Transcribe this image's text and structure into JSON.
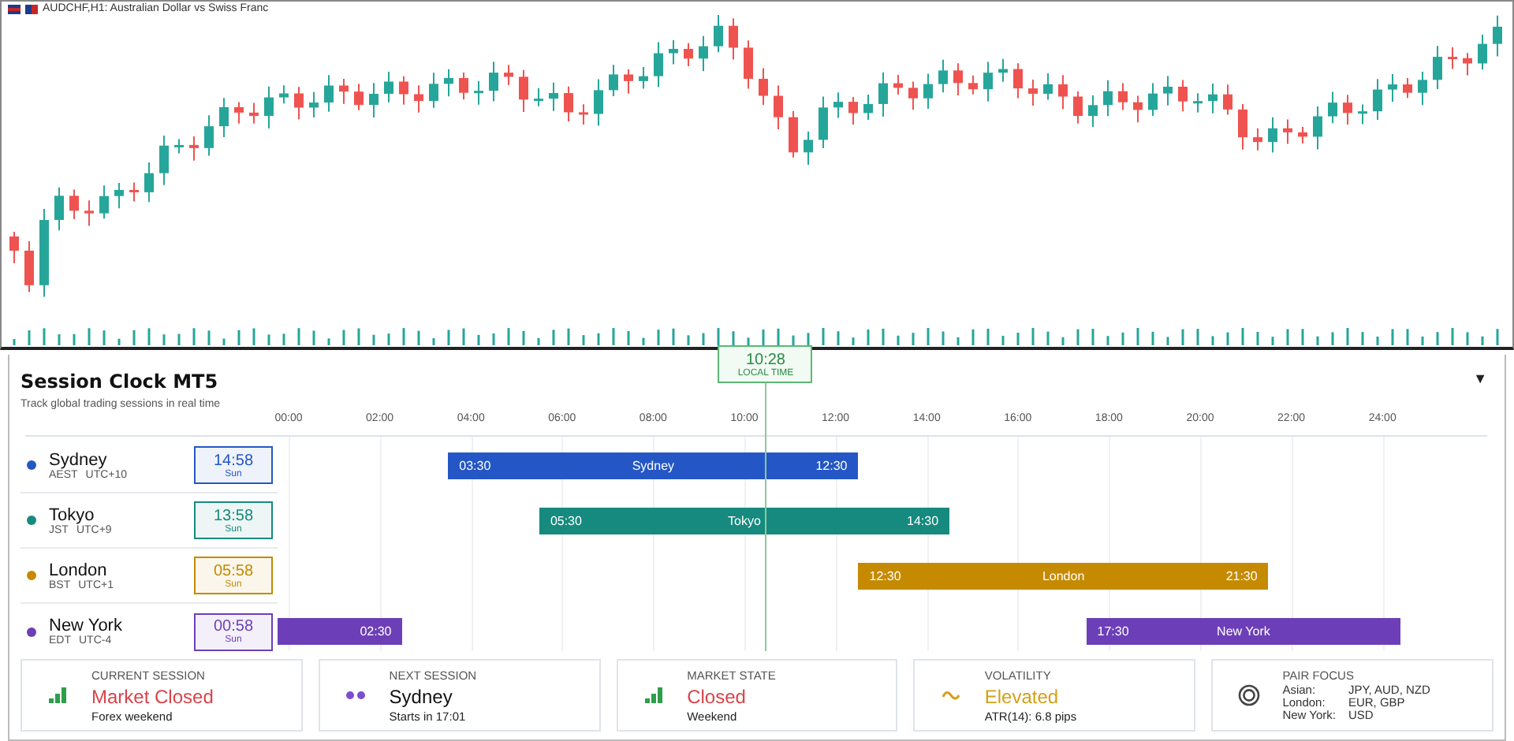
{
  "chart_window": {
    "title": "AUDCHF,H1: Australian Dollar vs Swiss Franc"
  },
  "session_clock": {
    "title": "Session Clock MT5",
    "subtitle": "Track global trading sessions in real time",
    "menu": "▼",
    "local_time": {
      "time": "10:28",
      "label": "LOCAL TIME"
    },
    "axis_labels": [
      "00:00",
      "02:00",
      "04:00",
      "06:00",
      "08:00",
      "10:00",
      "12:00",
      "14:00",
      "16:00",
      "18:00",
      "20:00",
      "22:00",
      "24:00"
    ],
    "sessions": [
      {
        "name": "Sydney",
        "zone": "AEST",
        "offset": "UTC+10",
        "time": "14:58",
        "day": "Sun",
        "color": "#2457c5",
        "open": "03:30",
        "close": "12:30",
        "bar_label": "Sydney"
      },
      {
        "name": "Tokyo",
        "zone": "JST",
        "offset": "UTC+9",
        "time": "13:58",
        "day": "Sun",
        "color": "#168a7e",
        "open": "05:30",
        "close": "14:30",
        "bar_label": "Tokyo"
      },
      {
        "name": "London",
        "zone": "BST",
        "offset": "UTC+1",
        "time": "05:58",
        "day": "Sun",
        "color": "#c58a00",
        "open": "12:30",
        "close": "21:30",
        "bar_label": "London"
      },
      {
        "name": "New York",
        "zone": "EDT",
        "offset": "UTC-4",
        "time": "00:58",
        "day": "Sun",
        "color": "#6c3fb8",
        "open": "17:30",
        "close": "02:30",
        "bar_label": "New York"
      }
    ]
  },
  "cards": [
    {
      "kind": "signal",
      "label": "CURRENT SESSION",
      "value": "Market Closed",
      "color": "#d9434a",
      "detail": "Forex weekend"
    },
    {
      "kind": "dots",
      "label": "NEXT SESSION",
      "value": "Sydney",
      "color": "#111111",
      "detail": "Starts in 17:01"
    },
    {
      "kind": "signal",
      "label": "MARKET STATE",
      "value": "Closed",
      "color": "#d9434a",
      "detail": "Weekend"
    },
    {
      "kind": "wave",
      "label": "VOLATILITY",
      "value": "Elevated",
      "color": "#d4a017",
      "detail": "ATR(14): 6.8 pips"
    },
    {
      "kind": "target",
      "label": "PAIR FOCUS",
      "pairs": [
        {
          "region": "Asian:",
          "list": "JPY, AUD, NZD"
        },
        {
          "region": "London:",
          "list": "EUR, GBP"
        },
        {
          "region": "New York:",
          "list": "USD"
        }
      ]
    }
  ]
}
